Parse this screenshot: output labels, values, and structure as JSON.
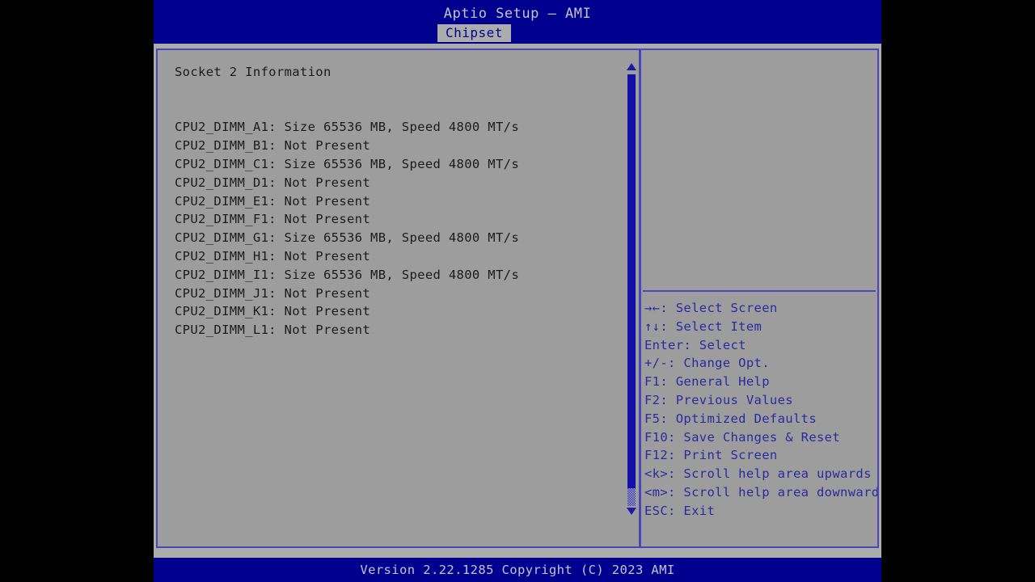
{
  "window": {
    "title": "Aptio Setup – AMI",
    "version_text": "Version 2.22.1285 Copyright (C) 2023 AMI"
  },
  "tabs": [
    {
      "label": "Chipset",
      "active": true
    }
  ],
  "main": {
    "heading": "Socket 2 Information",
    "dimms": [
      {
        "label": "CPU2_DIMM_A1:",
        "value": "Size 65536 MB, Speed 4800 MT/s",
        "text": "CPU2_DIMM_A1: Size 65536 MB, Speed 4800 MT/s"
      },
      {
        "label": "CPU2_DIMM_B1:",
        "value": "Not Present",
        "text": "CPU2_DIMM_B1: Not Present"
      },
      {
        "label": "CPU2_DIMM_C1:",
        "value": "Size 65536 MB, Speed 4800 MT/s",
        "text": "CPU2_DIMM_C1: Size 65536 MB, Speed 4800 MT/s"
      },
      {
        "label": "CPU2_DIMM_D1:",
        "value": "Not Present",
        "text": "CPU2_DIMM_D1: Not Present"
      },
      {
        "label": "CPU2_DIMM_E1:",
        "value": "Not Present",
        "text": "CPU2_DIMM_E1: Not Present"
      },
      {
        "label": "CPU2_DIMM_F1:",
        "value": "Not Present",
        "text": "CPU2_DIMM_F1: Not Present"
      },
      {
        "label": "CPU2_DIMM_G1:",
        "value": "Size 65536 MB, Speed 4800 MT/s",
        "text": "CPU2_DIMM_G1: Size 65536 MB, Speed 4800 MT/s"
      },
      {
        "label": "CPU2_DIMM_H1:",
        "value": "Not Present",
        "text": "CPU2_DIMM_H1: Not Present"
      },
      {
        "label": "CPU2_DIMM_I1:",
        "value": "Size 65536 MB, Speed 4800 MT/s",
        "text": "CPU2_DIMM_I1: Size 65536 MB, Speed 4800 MT/s"
      },
      {
        "label": "CPU2_DIMM_J1:",
        "value": "Not Present",
        "text": "CPU2_DIMM_J1: Not Present"
      },
      {
        "label": "CPU2_DIMM_K1:",
        "value": "Not Present",
        "text": "CPU2_DIMM_K1: Not Present"
      },
      {
        "label": "CPU2_DIMM_L1:",
        "value": "Not Present",
        "text": "CPU2_DIMM_L1: Not Present"
      }
    ]
  },
  "scrollbar": {
    "up_arrow_icon": "triangle-up-icon",
    "down_arrow_icon": "triangle-down-icon"
  },
  "help": {
    "description": "",
    "keys": [
      "→←: Select Screen",
      "↑↓: Select Item",
      "Enter: Select",
      "+/-: Change Opt.",
      "F1: General Help",
      "F2: Previous Values",
      "F5: Optimized Defaults",
      "F10: Save Changes & Reset",
      "F12: Print Screen",
      "<k>: Scroll help area upwards",
      "<m>: Scroll help area downwards",
      "ESC: Exit"
    ]
  },
  "colors": {
    "title_bar_bg": "#00008f",
    "panel_bg": "#9d9d9d",
    "frame_bg": "#acacac",
    "border": "#4b46b4",
    "help_text": "#2a2aa0",
    "body_text": "#1b1b1b",
    "title_text": "#c3c3d6",
    "tab_active_bg": "#acacac",
    "tab_active_text": "#00008f",
    "scrollbar_thumb": "#110fa8",
    "letterbox": "#000000"
  }
}
